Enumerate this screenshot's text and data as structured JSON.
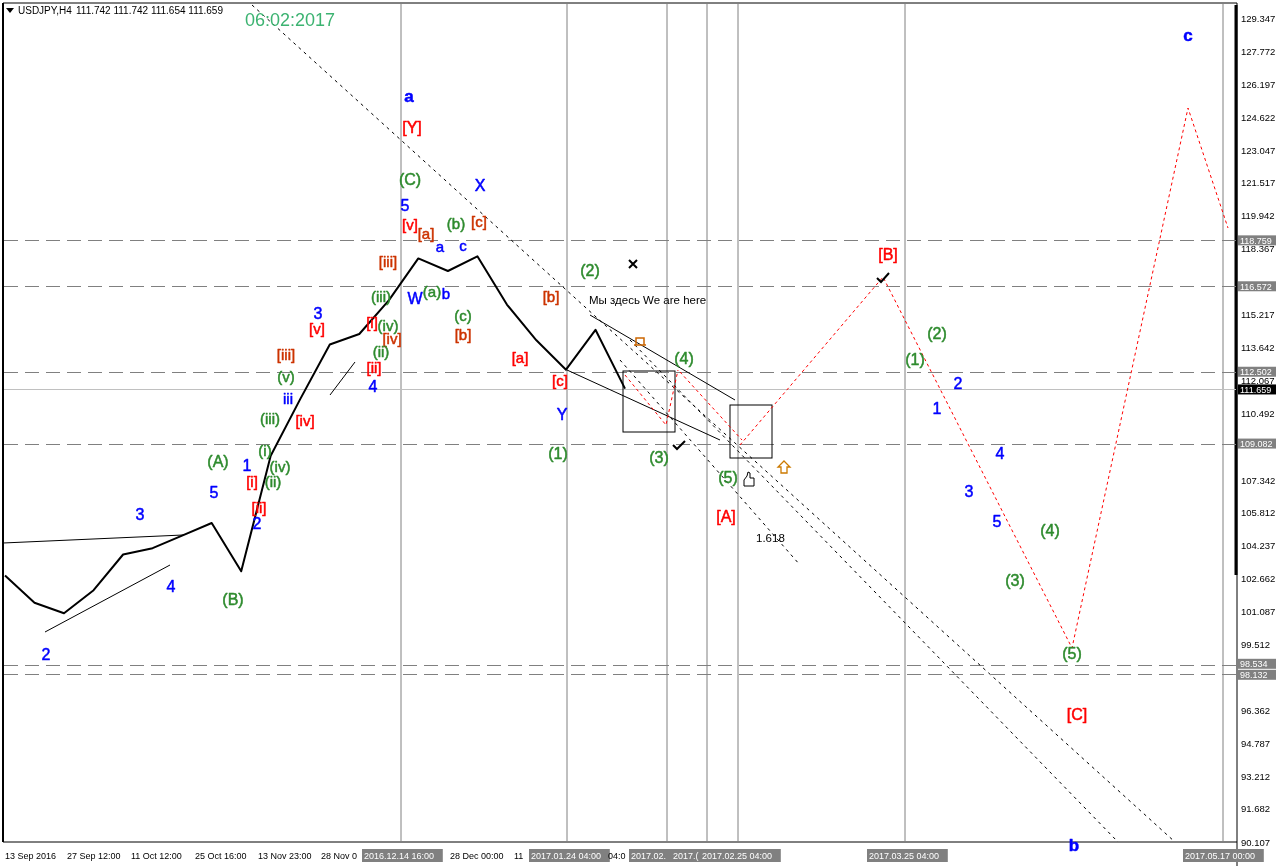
{
  "header": {
    "symbol": "USDJPY,H4",
    "ohlc": "111.742 111.742 111.654 111.659"
  },
  "date_stamp": "06:02:2017",
  "chart": {
    "price_scale": [
      "129.347",
      "127.772",
      "126.197",
      "124.622",
      "123.047",
      "121.517",
      "119.942",
      "118.367",
      "115.217",
      "113.642",
      "112.067",
      "110.492",
      "107.342",
      "105.812",
      "104.237",
      "102.662",
      "101.087",
      "99.512",
      "96.362",
      "94.787",
      "93.212",
      "91.682",
      "90.107"
    ],
    "price_levels": [
      {
        "label": "118.759",
        "kind": "level"
      },
      {
        "label": "116.572",
        "kind": "level"
      },
      {
        "label": "112.502",
        "kind": "level"
      },
      {
        "label": "111.659",
        "kind": "current"
      },
      {
        "label": "109.082",
        "kind": "level"
      },
      {
        "label": "98.534",
        "kind": "level"
      },
      {
        "label": "98.132",
        "kind": "level"
      }
    ],
    "time_labels": [
      {
        "label": "13 Sep 2016",
        "kind": "tick"
      },
      {
        "label": "27 Sep 12:00",
        "kind": "tick"
      },
      {
        "label": "11 Oct 12:00",
        "kind": "tick"
      },
      {
        "label": "25 Oct 16:00",
        "kind": "tick"
      },
      {
        "label": "13 Nov 23:00",
        "kind": "tick"
      },
      {
        "label": "28 Nov 0",
        "kind": "tick"
      },
      {
        "label": "2016.12.14 16:00",
        "kind": "marker"
      },
      {
        "label": "28 Dec 00:00",
        "kind": "tick"
      },
      {
        "label": "11",
        "kind": "tick"
      },
      {
        "label": "2017.01.24 04:00",
        "kind": "marker"
      },
      {
        "label": "04:0",
        "kind": "tick"
      },
      {
        "label": "2017.02.",
        "kind": "marker"
      },
      {
        "label": "2017.(",
        "kind": "marker"
      },
      {
        "label": "2017.02.25 04:00",
        "kind": "marker"
      },
      {
        "label": "2017.03.25 04:00",
        "kind": "marker"
      },
      {
        "label": "2017.05.17 00:00",
        "kind": "marker"
      }
    ],
    "wave_labels": [
      {
        "text": "a",
        "color": "#0000ff",
        "kind": "bold"
      },
      {
        "text": "[Y]",
        "color": "#ff0000",
        "kind": "wave"
      },
      {
        "text": "(C)",
        "color": "#2e8b2e",
        "kind": "wave"
      },
      {
        "text": "5",
        "color": "#0000ff",
        "kind": "wave"
      },
      {
        "text": "[v]",
        "color": "#ff0000",
        "kind": "minor"
      },
      {
        "text": "[a]",
        "color": "#cc3300",
        "kind": "minor"
      },
      {
        "text": "a",
        "color": "#0000ff",
        "kind": "minor"
      },
      {
        "text": "(b)",
        "color": "#2e8b2e",
        "kind": "minor"
      },
      {
        "text": "c",
        "color": "#0000ff",
        "kind": "minor"
      },
      {
        "text": "[c]",
        "color": "#cc3300",
        "kind": "minor"
      },
      {
        "text": "X",
        "color": "#0000ff",
        "kind": "wave"
      },
      {
        "text": "W",
        "color": "#0000ff",
        "kind": "wave"
      },
      {
        "text": "(a)",
        "color": "#2e8b2e",
        "kind": "minor"
      },
      {
        "text": "b",
        "color": "#0000ff",
        "kind": "minor"
      },
      {
        "text": "(c)",
        "color": "#2e8b2e",
        "kind": "minor"
      },
      {
        "text": "[b]",
        "color": "#cc3300",
        "kind": "minor"
      },
      {
        "text": "[iii]",
        "color": "#cc3300",
        "kind": "minor"
      },
      {
        "text": "(iii)",
        "color": "#2e8b2e",
        "kind": "minor"
      },
      {
        "text": "[i]",
        "color": "#ff0000",
        "kind": "minor"
      },
      {
        "text": "(iv)",
        "color": "#2e8b2e",
        "kind": "minor"
      },
      {
        "text": "[iv]",
        "color": "#cc3300",
        "kind": "minor"
      },
      {
        "text": "(ii)",
        "color": "#2e8b2e",
        "kind": "minor"
      },
      {
        "text": "[ii]",
        "color": "#ff0000",
        "kind": "minor"
      },
      {
        "text": "4",
        "color": "#0000ff",
        "kind": "wave"
      },
      {
        "text": "3",
        "color": "#0000ff",
        "kind": "wave"
      },
      {
        "text": "[v]",
        "color": "#ff0000",
        "kind": "minor"
      },
      {
        "text": "[iii]",
        "color": "#cc3300",
        "kind": "minor"
      },
      {
        "text": "(v)",
        "color": "#2e8b2e",
        "kind": "minor"
      },
      {
        "text": "iii",
        "color": "#0000ff",
        "kind": "minor"
      },
      {
        "text": "(iii)",
        "color": "#2e8b2e",
        "kind": "minor"
      },
      {
        "text": "[iv]",
        "color": "#ff0000",
        "kind": "minor"
      },
      {
        "text": "(i)",
        "color": "#2e8b2e",
        "kind": "minor"
      },
      {
        "text": "1",
        "color": "#0000ff",
        "kind": "wave"
      },
      {
        "text": "(iv)",
        "color": "#2e8b2e",
        "kind": "minor"
      },
      {
        "text": "[i]",
        "color": "#ff0000",
        "kind": "minor"
      },
      {
        "text": "(ii)",
        "color": "#2e8b2e",
        "kind": "minor"
      },
      {
        "text": "[ii]",
        "color": "#ff0000",
        "kind": "minor"
      },
      {
        "text": "2",
        "color": "#0000ff",
        "kind": "wave"
      },
      {
        "text": "(A)",
        "color": "#2e8b2e",
        "kind": "wave"
      },
      {
        "text": "5",
        "color": "#0000ff",
        "kind": "wave"
      },
      {
        "text": "3",
        "color": "#0000ff",
        "kind": "wave"
      },
      {
        "text": "4",
        "color": "#0000ff",
        "kind": "wave"
      },
      {
        "text": "(B)",
        "color": "#2e8b2e",
        "kind": "wave"
      },
      {
        "text": "2",
        "color": "#0000ff",
        "kind": "wave"
      },
      {
        "text": "[a]",
        "color": "#ff0000",
        "kind": "minor"
      },
      {
        "text": "[b]",
        "color": "#cc3300",
        "kind": "minor"
      },
      {
        "text": "[c]",
        "color": "#ff0000",
        "kind": "minor"
      },
      {
        "text": "Y",
        "color": "#0000ff",
        "kind": "wave"
      },
      {
        "text": "(1)",
        "color": "#2e8b2e",
        "kind": "wave"
      },
      {
        "text": "(2)",
        "color": "#2e8b2e",
        "kind": "wave"
      },
      {
        "text": "(4)",
        "color": "#2e8b2e",
        "kind": "wave"
      },
      {
        "text": "(3)",
        "color": "#2e8b2e",
        "kind": "wave"
      },
      {
        "text": "(5)",
        "color": "#2e8b2e",
        "kind": "wave"
      },
      {
        "text": "[A]",
        "color": "#ff0000",
        "kind": "wave"
      },
      {
        "text": "[B]",
        "color": "#ff0000",
        "kind": "wave"
      },
      {
        "text": "(1)",
        "color": "#2e8b2e",
        "kind": "wave"
      },
      {
        "text": "(2)",
        "color": "#2e8b2e",
        "kind": "wave"
      },
      {
        "text": "2",
        "color": "#0000ff",
        "kind": "wave"
      },
      {
        "text": "1",
        "color": "#0000ff",
        "kind": "wave"
      },
      {
        "text": "4",
        "color": "#0000ff",
        "kind": "wave"
      },
      {
        "text": "3",
        "color": "#0000ff",
        "kind": "wave"
      },
      {
        "text": "5",
        "color": "#0000ff",
        "kind": "wave"
      },
      {
        "text": "(4)",
        "color": "#2e8b2e",
        "kind": "wave"
      },
      {
        "text": "(3)",
        "color": "#2e8b2e",
        "kind": "wave"
      },
      {
        "text": "(5)",
        "color": "#2e8b2e",
        "kind": "wave"
      },
      {
        "text": "[C]",
        "color": "#ff0000",
        "kind": "wave"
      },
      {
        "text": "b",
        "color": "#0000ff",
        "kind": "bold"
      },
      {
        "text": "c",
        "color": "#0000ff",
        "kind": "bold"
      }
    ],
    "notes": [
      {
        "text": "Мы здесь We are here"
      },
      {
        "text": "1.618"
      }
    ]
  }
}
